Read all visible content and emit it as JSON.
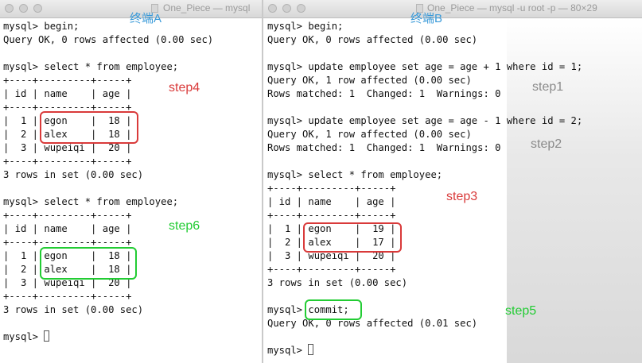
{
  "windows": {
    "a": {
      "title": "One_Piece — mysql",
      "caption": "终端A",
      "lines": [
        "mysql> begin;",
        "Query OK, 0 rows affected (0.00 sec)",
        "",
        "mysql> select * from employee;",
        "+----+---------+-----+",
        "| id | name    | age |",
        "+----+---------+-----+",
        "|  1 | egon    |  18 |",
        "|  2 | alex    |  18 |",
        "|  3 | wupeiqi |  20 |",
        "+----+---------+-----+",
        "3 rows in set (0.00 sec)",
        "",
        "mysql> select * from employee;",
        "+----+---------+-----+",
        "| id | name    | age |",
        "+----+---------+-----+",
        "|  1 | egon    |  18 |",
        "|  2 | alex    |  18 |",
        "|  3 | wupeiqi |  20 |",
        "+----+---------+-----+",
        "3 rows in set (0.00 sec)",
        "",
        "mysql> "
      ],
      "annotations": {
        "step4": "step4",
        "step6": "step6"
      }
    },
    "b": {
      "title": "One_Piece — mysql -u root -p — 80×29",
      "caption": "终端B",
      "lines": [
        "mysql> begin;",
        "Query OK, 0 rows affected (0.00 sec)",
        "",
        "mysql> update employee set age = age + 1 where id = 1;",
        "Query OK, 1 row affected (0.00 sec)",
        "Rows matched: 1  Changed: 1  Warnings: 0",
        "",
        "mysql> update employee set age = age - 1 where id = 2;",
        "Query OK, 1 row affected (0.00 sec)",
        "Rows matched: 1  Changed: 1  Warnings: 0",
        "",
        "mysql> select * from employee;",
        "+----+---------+-----+",
        "| id | name    | age |",
        "+----+---------+-----+",
        "|  1 | egon    |  19 |",
        "|  2 | alex    |  17 |",
        "|  3 | wupeiqi |  20 |",
        "+----+---------+-----+",
        "3 rows in set (0.00 sec)",
        "",
        "mysql> commit;",
        "Query OK, 0 rows affected (0.01 sec)",
        "",
        "mysql> "
      ],
      "annotations": {
        "step1": "step1",
        "step2": "step2",
        "step3": "step3",
        "step5": "step5"
      }
    }
  },
  "colors": {
    "caption": "#3a9ad9",
    "red_step": "#d93a3a",
    "gray_step": "#8a8a8a",
    "green_step": "#22cc33"
  }
}
